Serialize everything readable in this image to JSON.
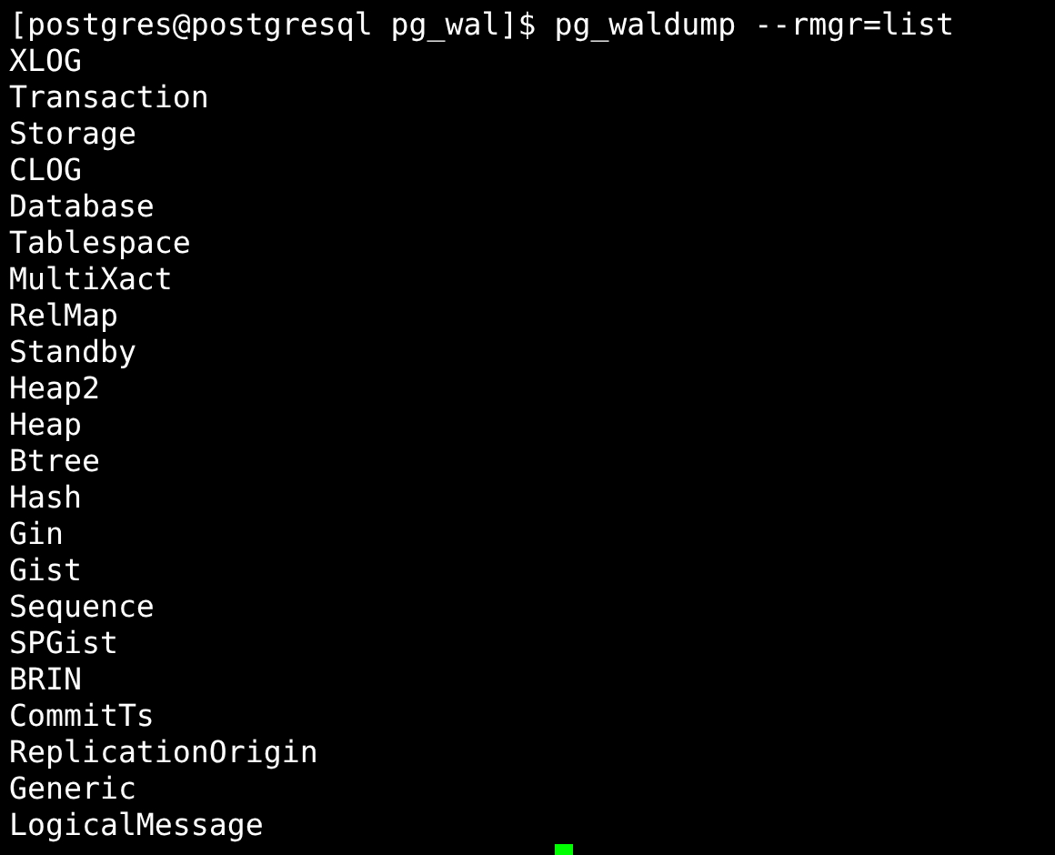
{
  "terminal": {
    "command_line": "[postgres@postgresql pg_wal]$ pg_waldump --rmgr=list",
    "output": [
      "XLOG",
      "Transaction",
      "Storage",
      "CLOG",
      "Database",
      "Tablespace",
      "MultiXact",
      "RelMap",
      "Standby",
      "Heap2",
      "Heap",
      "Btree",
      "Hash",
      "Gin",
      "Gist",
      "Sequence",
      "SPGist",
      "BRIN",
      "CommitTs",
      "ReplicationOrigin",
      "Generic",
      "LogicalMessage"
    ],
    "cursor_visible": true
  }
}
